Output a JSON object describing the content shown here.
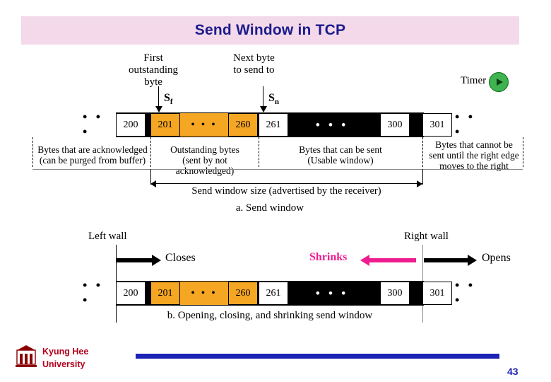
{
  "slide": {
    "title": "Send Window in TCP",
    "page_number": "43",
    "title_bg": "#f3d9ea",
    "title_color": "#1c1c8c"
  },
  "figure": {
    "panel_a": {
      "caption": "a. Send window",
      "annotations": {
        "first_outstanding": "First\noutstanding\nbyte",
        "next_byte": "Next byte\nto send to",
        "timer": "Timer",
        "sf": "S",
        "sf_sub": "f",
        "sn": "S",
        "sn_sub": "n"
      },
      "left_dots": "• • •",
      "right_dots": "• • •",
      "cells": [
        {
          "label": "200",
          "style": "white"
        },
        {
          "label": "201",
          "style": "orange"
        },
        {
          "label": "• • •",
          "style": "orange-dots"
        },
        {
          "label": "260",
          "style": "orange"
        },
        {
          "label": "261",
          "style": "white"
        },
        {
          "label": "• • •",
          "style": "black-dots"
        },
        {
          "label": "300",
          "style": "white"
        },
        {
          "label": "301",
          "style": "white"
        }
      ],
      "regions": [
        "Bytes that are acknowledged\n(can be purged from buffer)",
        "Outstanding bytes\n(sent by not acknowledged)",
        "Bytes that can be sent\n(Usable window)",
        "Bytes that cannot be\nsent until the right edge\nmoves to the right"
      ],
      "window_label": "Send window size (advertised by the receiver)"
    },
    "panel_b": {
      "caption": "b. Opening, closing, and shrinking send window",
      "left_wall": "Left wall",
      "right_wall": "Right wall",
      "closes": "Closes",
      "shrinks": "Shrinks",
      "opens": "Opens",
      "shrinks_color": "#ee1d8f",
      "left_dots": "• • •",
      "right_dots": "• • •",
      "cells": [
        {
          "label": "200",
          "style": "white"
        },
        {
          "label": "201",
          "style": "orange"
        },
        {
          "label": "• • •",
          "style": "orange-dots"
        },
        {
          "label": "260",
          "style": "orange"
        },
        {
          "label": "261",
          "style": "white"
        },
        {
          "label": "• • •",
          "style": "black-dots"
        },
        {
          "label": "300",
          "style": "white"
        },
        {
          "label": "301",
          "style": "white"
        }
      ]
    }
  },
  "footer": {
    "university_line1": "Kyung Hee",
    "university_line2": "University",
    "accent_color": "#1c24b5",
    "text_color": "#b3001b"
  }
}
